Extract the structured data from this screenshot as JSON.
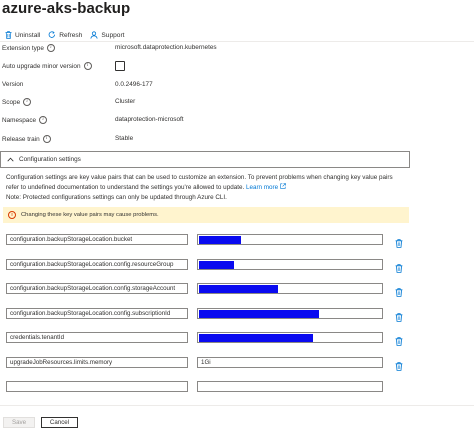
{
  "header": {
    "title": "azure-aks-backup",
    "more": "···"
  },
  "toolbar": {
    "uninstall": "Uninstall",
    "refresh": "Refresh",
    "support": "Support"
  },
  "properties": [
    {
      "label": "Extension type",
      "value": "microsoft.dataprotection.kubernetes",
      "info": true
    },
    {
      "label": "Auto upgrade minor version",
      "value": "",
      "info": true
    },
    {
      "label": "Version",
      "value": "0.0.2496-177",
      "info": false
    },
    {
      "label": "Scope",
      "value": "Cluster",
      "info": true
    },
    {
      "label": "Namespace",
      "value": "dataprotection-microsoft",
      "info": true
    },
    {
      "label": "Release train",
      "value": "Stable",
      "info": true
    }
  ],
  "config": {
    "section_title": "Configuration settings",
    "description": "Configuration settings are key value pairs that can be used to customize an extension. To prevent problems when changing key value pairs refer to undefined documentation to understand the settings you're allowed to update.",
    "learn_more": "Learn more",
    "note": "Note: Protected configurations settings can only be updated through Azure CLI.",
    "warning": "Changing these key value pairs may cause problems.",
    "rows": [
      {
        "key": "configuration.backupStorageLocation.bucket",
        "value": "",
        "redacted_fraction": 0.23
      },
      {
        "key": "configuration.backupStorageLocation.config.resourceGroup",
        "value": "",
        "redacted_fraction": 0.19
      },
      {
        "key": "configuration.backupStorageLocation.config.storageAccount",
        "value": "",
        "redacted_fraction": 0.43
      },
      {
        "key": "configuration.backupStorageLocation.config.subscriptionId",
        "value": "",
        "redacted_fraction": 0.65
      },
      {
        "key": "credentials.tenantId",
        "value": "",
        "redacted_fraction": 0.62
      },
      {
        "key": "upgradeJobResources.limits.memory",
        "value": "1Gi",
        "redacted_fraction": 0
      },
      {
        "key": "",
        "value": "",
        "redacted_fraction": 0
      }
    ]
  },
  "footer": {
    "save": "Save",
    "cancel": "Cancel"
  },
  "colors": {
    "accent": "#0078d4",
    "redaction": "#0a0af0",
    "warning_bg": "#fff4ce"
  }
}
